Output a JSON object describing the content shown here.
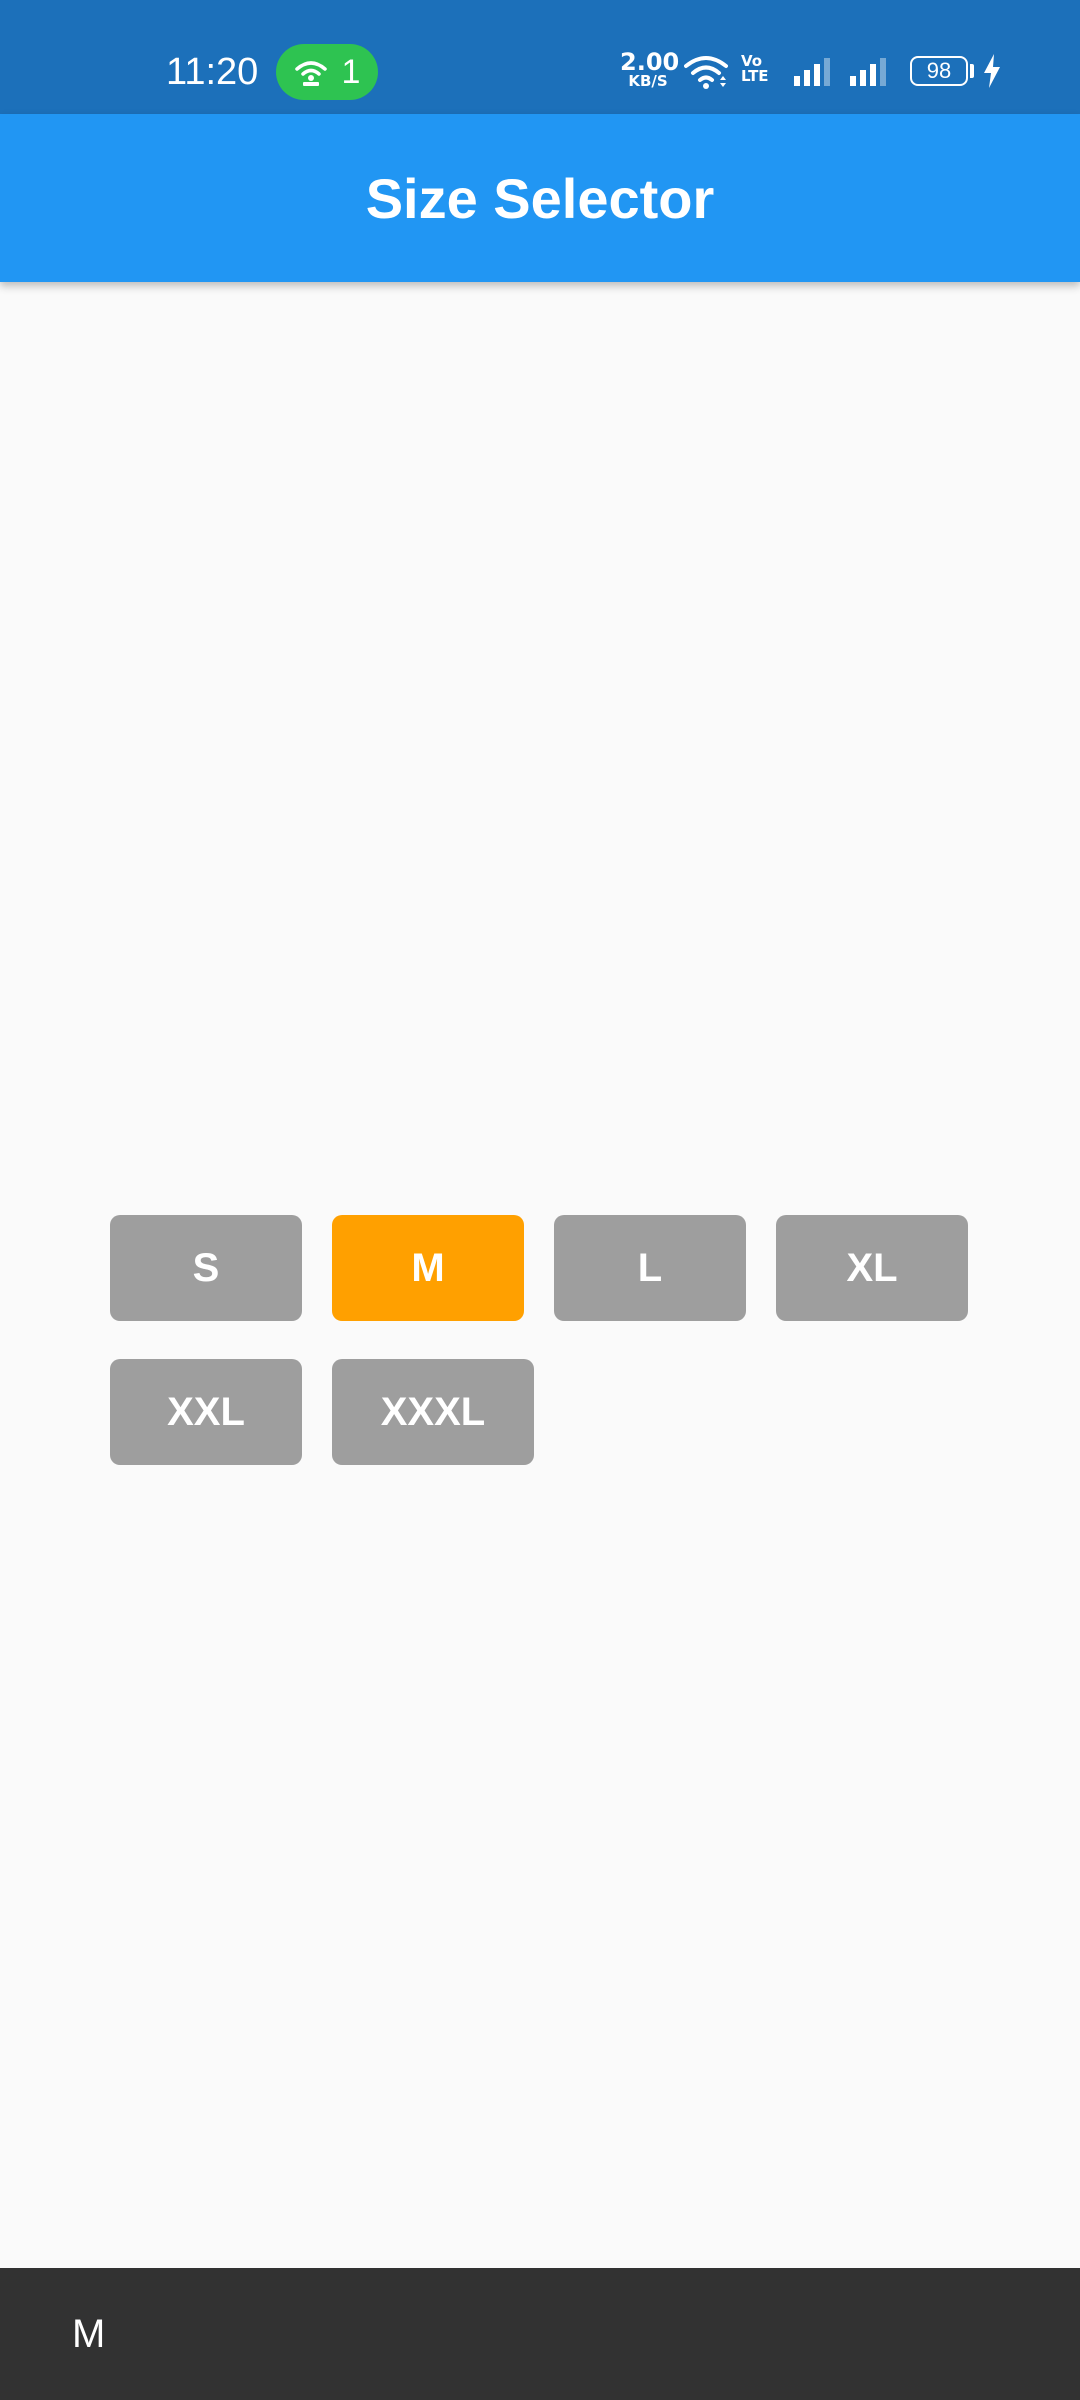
{
  "status_bar": {
    "time": "11:20",
    "hotspot_count": "1",
    "net_speed_value": "2.00",
    "net_speed_unit": "KB/S",
    "volte_top": "Vo",
    "volte_bottom": "LTE",
    "battery_level": "98",
    "icons": [
      "hotspot-icon",
      "wifi-icon",
      "volte-icon",
      "signal-icon",
      "signal-icon",
      "battery-icon",
      "charging-icon"
    ]
  },
  "app_bar": {
    "title": "Size Selector"
  },
  "sizes": {
    "options": [
      "S",
      "M",
      "L",
      "XL",
      "XXL",
      "XXXL"
    ],
    "selected": "M",
    "colors": {
      "default": "#9E9E9E",
      "selected": "#FFA000"
    }
  },
  "snackbar": {
    "message": "M"
  },
  "colors": {
    "status_bar": "#1C70BA",
    "app_bar": "#2196F3",
    "background": "#FAFAFA",
    "snackbar": "#323232",
    "hotspot_pill": "#2EC351"
  }
}
